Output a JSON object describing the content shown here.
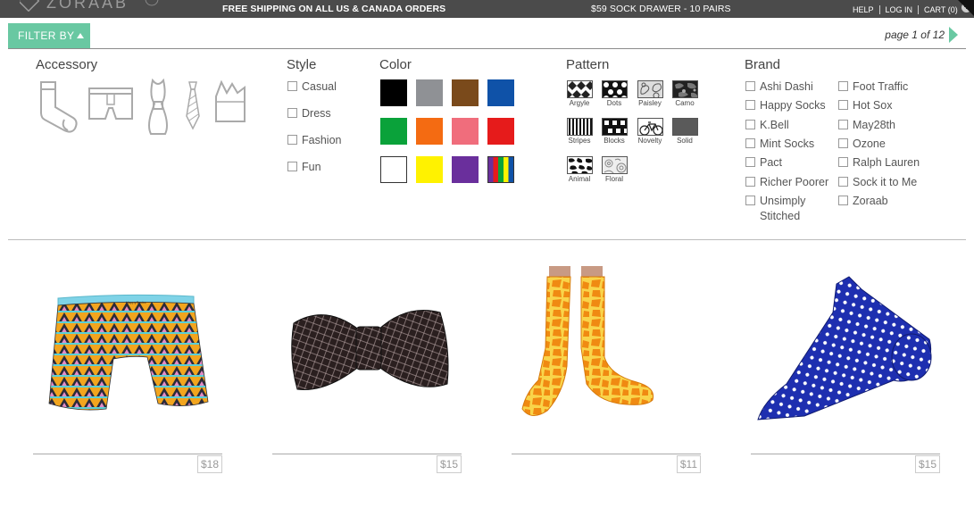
{
  "topbar": {
    "brand": "ZORAAB",
    "promo_shipping": "FREE SHIPPING ON ALL US & CANADA ORDERS",
    "promo_sock_drawer": "$59 SOCK DRAWER - 10 PAIRS",
    "links": [
      "HELP",
      "LOG IN",
      "CART (0)"
    ]
  },
  "filter": {
    "button_label": "FILTER BY",
    "pager": "page 1 of 12"
  },
  "accessory": {
    "heading": "Accessory",
    "icons": [
      "sock-icon",
      "underwear-icon",
      "bow-tie-icon",
      "tie-icon",
      "pocket-square-icon"
    ]
  },
  "style": {
    "heading": "Style",
    "options": [
      "Casual",
      "Dress",
      "Fashion",
      "Fun"
    ]
  },
  "color": {
    "heading": "Color",
    "swatches": [
      "#000000",
      "#8f9195",
      "#7a4a1b",
      "#0f52a8",
      "#0aa23a",
      "#f46b12",
      "#f06d7c",
      "#e61b1b",
      "#ffffff",
      "#fff200",
      "#6a2f9c",
      "multi"
    ]
  },
  "pattern": {
    "heading": "Pattern",
    "items": [
      "Argyle",
      "Dots",
      "Paisley",
      "Camo",
      "Stripes",
      "Blocks",
      "Novelty",
      "Solid",
      "Animal",
      "Floral"
    ]
  },
  "brand": {
    "heading": "Brand",
    "col1": [
      "Ashi Dashi",
      "Happy Socks",
      "K.Bell",
      "Mint Socks",
      "Pact",
      "Richer Poorer",
      "Unsimply Stitched"
    ],
    "col2": [
      "Foot Traffic",
      "Hot Sox",
      "May28th",
      "Ozone",
      "Ralph Lauren",
      "Sock it to Me",
      "Zoraab"
    ]
  },
  "products": [
    {
      "name": "boxer-brief",
      "price": "$18"
    },
    {
      "name": "bow-tie",
      "price": "$15"
    },
    {
      "name": "giraffe-socks",
      "price": "$11"
    },
    {
      "name": "polka-dot-tie",
      "price": "$15"
    }
  ],
  "colors": {
    "accent": "#69c8a2",
    "topbar": "#4b4b4b"
  }
}
